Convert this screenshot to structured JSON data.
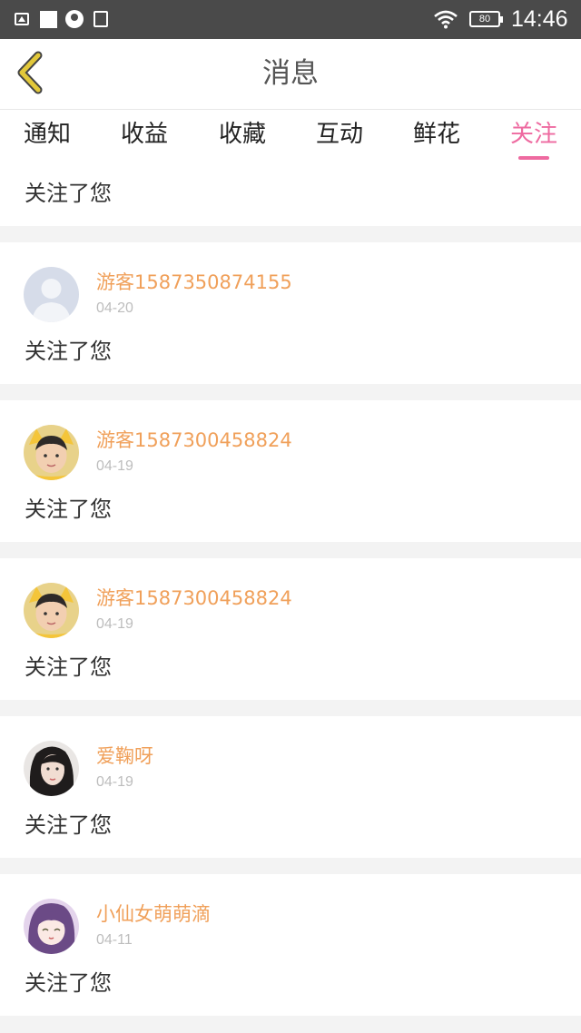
{
  "status_bar": {
    "battery": "80",
    "time": "14:46",
    "icons": [
      "image-icon",
      "square-icon",
      "globe-icon",
      "screenshot-icon",
      "wifi-icon",
      "battery-icon"
    ]
  },
  "header": {
    "title": "消息",
    "back_icon": "chevron-left-icon"
  },
  "tabs": [
    {
      "label": "通知",
      "active": false
    },
    {
      "label": "收益",
      "active": false
    },
    {
      "label": "收藏",
      "active": false
    },
    {
      "label": "互动",
      "active": false
    },
    {
      "label": "鲜花",
      "active": false
    },
    {
      "label": "关注",
      "active": true
    }
  ],
  "colors": {
    "accent": "#ee6aa0",
    "username": "#f0a05a",
    "date": "#bdbdbd",
    "back_arrow": "#e2c83a"
  },
  "first_item": {
    "message": "关注了您"
  },
  "messages": [
    {
      "username": "游客1587350874155",
      "date": "04-20",
      "message": "关注了您",
      "avatar": "default-avatar"
    },
    {
      "username": "游客1587300458824",
      "date": "04-19",
      "message": "关注了您",
      "avatar": "boy-avatar"
    },
    {
      "username": "游客1587300458824",
      "date": "04-19",
      "message": "关注了您",
      "avatar": "boy-avatar"
    },
    {
      "username": "爱鞠呀",
      "date": "04-19",
      "message": "关注了您",
      "avatar": "girl-avatar"
    },
    {
      "username": "小仙女萌萌滴",
      "date": "04-11",
      "message": "关注了您",
      "avatar": "anime-avatar"
    }
  ]
}
